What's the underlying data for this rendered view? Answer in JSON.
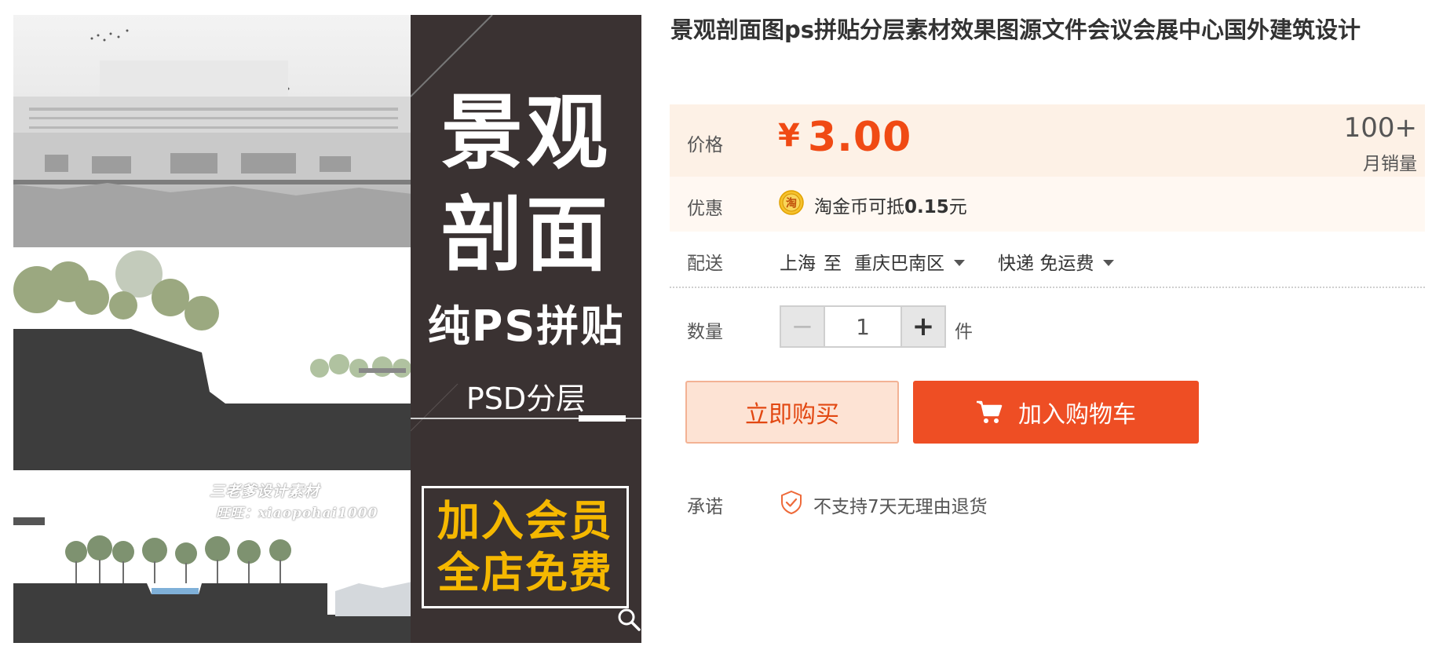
{
  "product_image": {
    "banner_title_line1": "景观",
    "banner_title_line2": "剖面",
    "banner_subtitle": "纯PS拼贴",
    "banner_format": "PSD分层",
    "member_line1": "加入会员",
    "member_line2": "全店免费",
    "watermark_line1": "三老爹设计素材",
    "watermark_line2": "旺旺：xiaopohai1000",
    "zoom_icon": "magnifier-icon"
  },
  "product": {
    "title": "景观剖面图ps拼贴分层素材效果图源文件会议会展中心国外建筑设计"
  },
  "price": {
    "label": "价格",
    "currency": "¥",
    "value": "3.00",
    "monthly_sales_count": "100+",
    "monthly_sales_label": "月销量"
  },
  "promo": {
    "label": "优惠",
    "coin_icon": "taobao-coin-icon",
    "text_prefix": "淘金币可抵",
    "amount": "0.15",
    "unit": "元"
  },
  "delivery": {
    "label": "配送",
    "from": "上海",
    "to_word": "至",
    "destination": "重庆巴南区",
    "shipping_method": "快递",
    "shipping_fee": "免运费"
  },
  "quantity": {
    "label": "数量",
    "value": "1",
    "minus": "−",
    "plus": "+",
    "unit": "件"
  },
  "actions": {
    "buy_now": "立即购买",
    "add_to_cart": "加入购物车"
  },
  "promise": {
    "label": "承诺",
    "text": "不支持7天无理由退货"
  },
  "colors": {
    "accent": "#ee4e24",
    "price": "#f04a14",
    "price_bg": "#fdf1e6",
    "banner_bg": "#3a3232",
    "member_text": "#f5b800"
  }
}
